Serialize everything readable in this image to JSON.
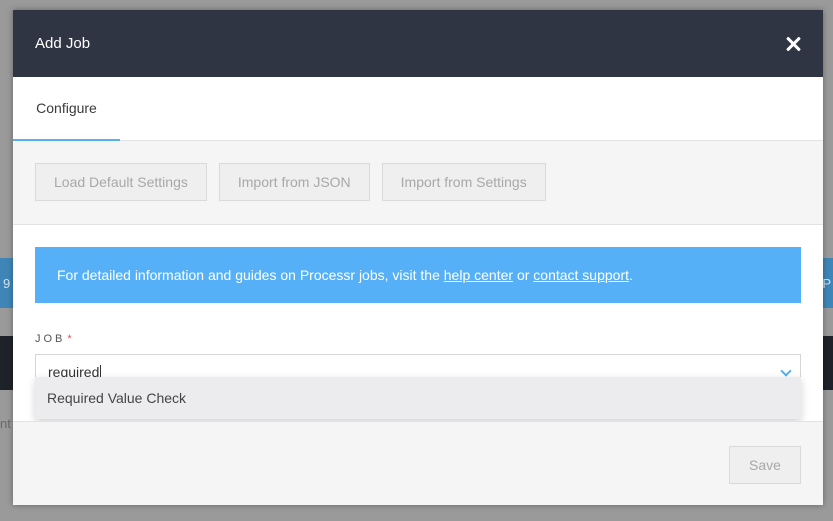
{
  "background": {
    "frag_left": "9",
    "frag_right": "P",
    "frag_text": "nt"
  },
  "modal": {
    "title": "Add Job",
    "close_icon": "close-icon"
  },
  "tabs": [
    {
      "label": "Configure",
      "active": true
    }
  ],
  "toolbar": {
    "load_default": "Load Default Settings",
    "import_json": "Import from JSON",
    "import_settings": "Import from Settings"
  },
  "info": {
    "prefix": "For detailed information and guides on Processr jobs, visit the ",
    "help_link": "help center",
    "middle": " or ",
    "support_link": "contact support",
    "suffix": "."
  },
  "job_field": {
    "label": "JOB",
    "required_mark": "*",
    "value": "required",
    "options": [
      "Required Value Check"
    ]
  },
  "footer": {
    "save_label": "Save"
  },
  "colors": {
    "header_bg": "#2f3542",
    "accent": "#56b0f0",
    "info_bg": "#56b0f8",
    "required": "#e0524f"
  }
}
